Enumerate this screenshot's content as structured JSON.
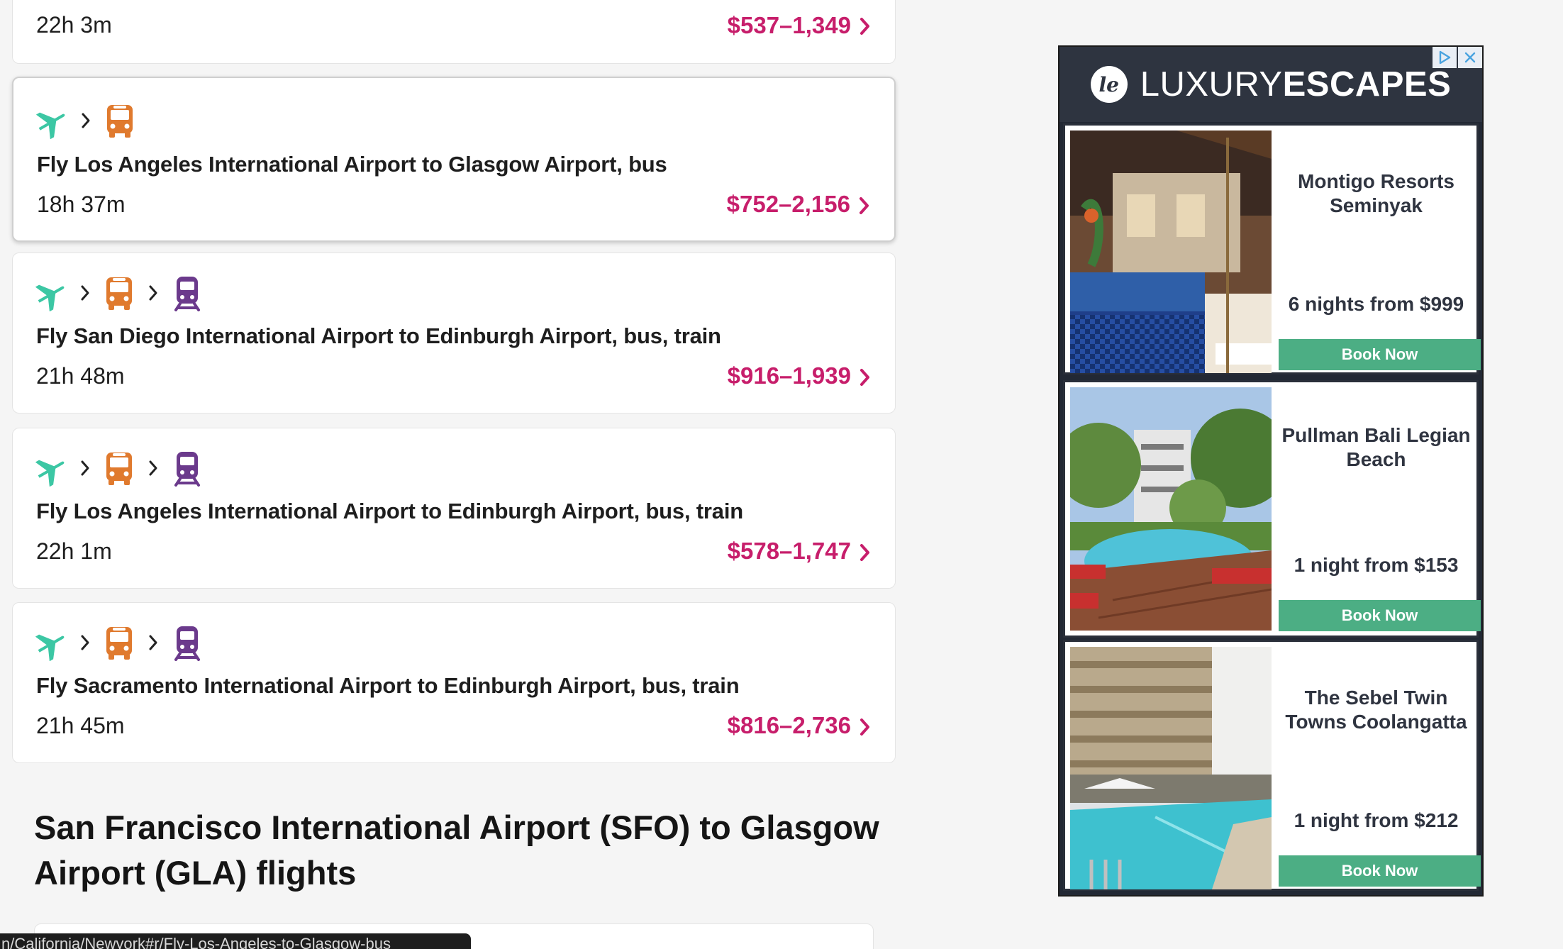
{
  "routes": [
    {
      "title": "",
      "duration": "22h 3m",
      "price": "$537–1,349",
      "modes": []
    },
    {
      "title": "Fly Los Angeles International Airport to Glasgow Airport, bus",
      "duration": "18h 37m",
      "price": "$752–2,156",
      "modes": [
        "plane-icon",
        "bus-icon"
      ]
    },
    {
      "title": "Fly San Diego International Airport to Edinburgh Airport, bus, train",
      "duration": "21h 48m",
      "price": "$916–1,939",
      "modes": [
        "plane-icon",
        "bus-icon",
        "train-icon"
      ]
    },
    {
      "title": "Fly Los Angeles International Airport to Edinburgh Airport, bus, train",
      "duration": "22h 1m",
      "price": "$578–1,747",
      "modes": [
        "plane-icon",
        "bus-icon",
        "train-icon"
      ]
    },
    {
      "title": "Fly Sacramento International Airport to Edinburgh Airport, bus, train",
      "duration": "21h 45m",
      "price": "$816–2,736",
      "modes": [
        "plane-icon",
        "bus-icon",
        "train-icon"
      ]
    }
  ],
  "section": {
    "heading": "San Francisco International Airport (SFO) to Glasgow Airport (GLA) flights"
  },
  "status_bar": {
    "url": "n/California/Newyork#r/Fly-Los-Angeles-to-Glasgow-bus"
  },
  "ad": {
    "brand_light": "LUXURY",
    "brand_bold": "ESCAPES",
    "logo_mark": "le",
    "hotels": [
      {
        "name": "Montigo Resorts Seminyak",
        "offer": "6 nights from $999",
        "button": "Book Now"
      },
      {
        "name": "Pullman Bali Legian Beach",
        "offer": "1 night from $153",
        "button": "Book Now"
      },
      {
        "name": "The Sebel Twin Towns Coolangatta",
        "offer": "1 night from $212",
        "button": "Book Now"
      }
    ]
  },
  "colors": {
    "plane": "#3cc7a4",
    "bus": "#e07a2e",
    "train": "#6b3a8c",
    "price": "#c71e6b",
    "book_button": "#4cae84",
    "ad_header": "#2e3440"
  }
}
